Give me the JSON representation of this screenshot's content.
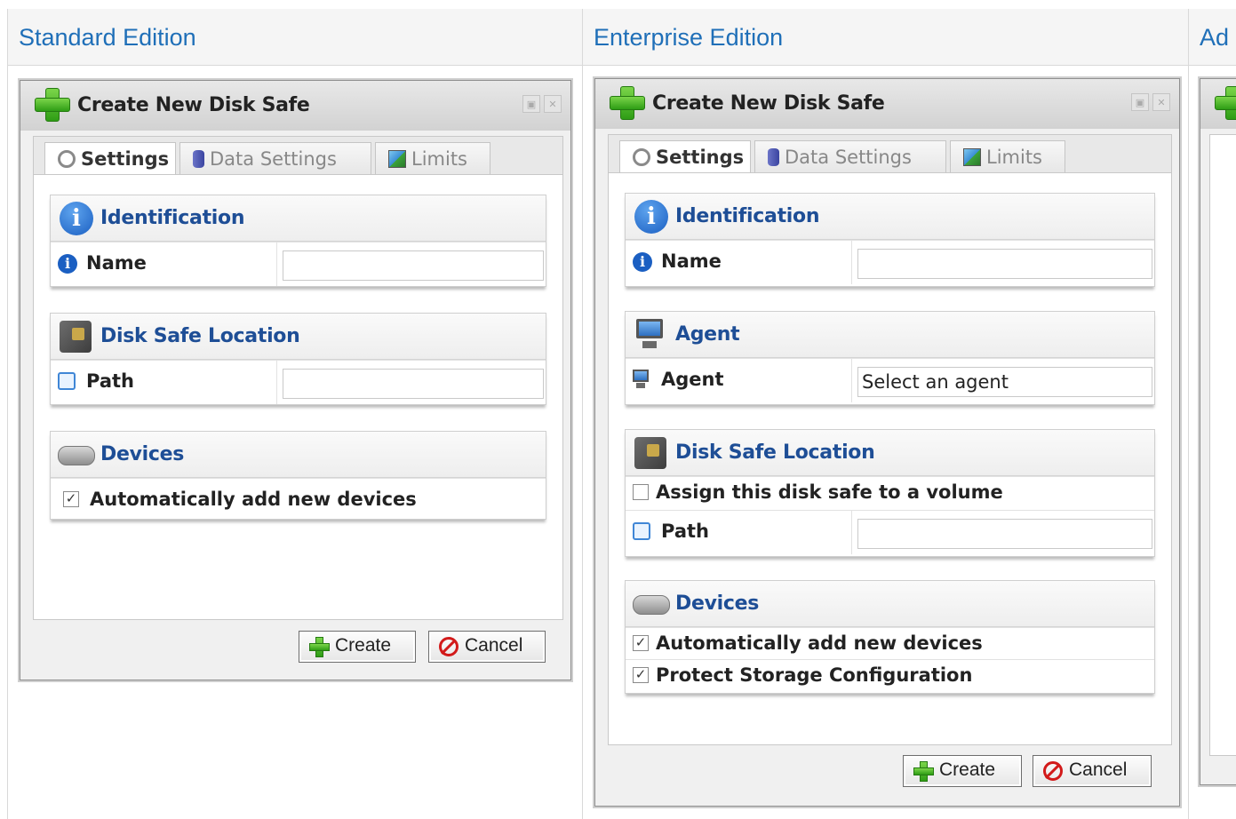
{
  "columns": [
    {
      "heading": "Standard Edition"
    },
    {
      "heading": "Enterprise Edition"
    },
    {
      "heading": "Ad"
    }
  ],
  "dialog": {
    "title": "Create New Disk Safe",
    "tabs": [
      "Settings",
      "Data Settings",
      "Limits"
    ],
    "active_tab": "Settings",
    "buttons": {
      "create": "Create",
      "cancel": "Cancel"
    }
  },
  "standard": {
    "sections": {
      "identification": {
        "title": "Identification",
        "name_label": "Name",
        "name_value": ""
      },
      "location": {
        "title": "Disk Safe Location",
        "path_label": "Path",
        "path_value": ""
      },
      "devices": {
        "title": "Devices",
        "auto_add_label": "Automatically add new devices",
        "auto_add_checked": true
      }
    }
  },
  "enterprise": {
    "sections": {
      "identification": {
        "title": "Identification",
        "name_label": "Name",
        "name_value": ""
      },
      "agent": {
        "title": "Agent",
        "agent_label": "Agent",
        "agent_value": "Select an agent"
      },
      "location": {
        "title": "Disk Safe Location",
        "assign_label": "Assign this disk safe to a volume",
        "assign_checked": false,
        "path_label": "Path",
        "path_value": ""
      },
      "devices": {
        "title": "Devices",
        "auto_add_label": "Automatically add new devices",
        "auto_add_checked": true,
        "protect_label": "Protect Storage Configuration",
        "protect_checked": true
      }
    }
  },
  "icons": {
    "title": "plus-icon",
    "tab_settings": "gear-icon",
    "tab_data": "database-icon",
    "tab_limits": "chart-icon",
    "identification": "info-icon",
    "location": "safe-icon",
    "devices": "disk-icon",
    "agent": "monitor-icon",
    "path": "tree-icon",
    "create": "plus-icon",
    "cancel": "cancel-icon"
  },
  "colors": {
    "heading": "#1f6fb8",
    "section_title": "#1e4e96",
    "accent_green": "#2e9d15",
    "cancel_red": "#d21a1a"
  }
}
